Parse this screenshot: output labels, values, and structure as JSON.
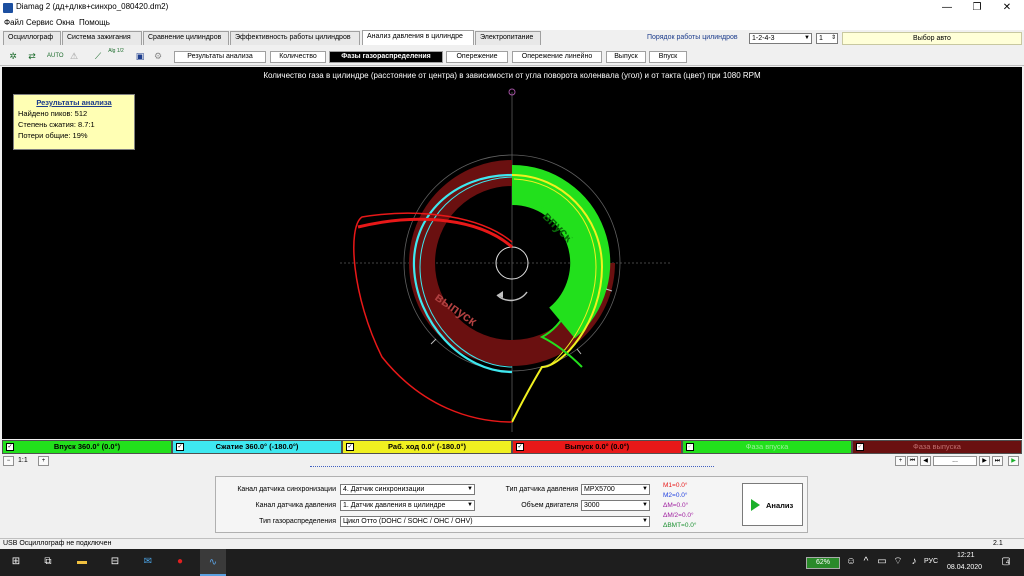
{
  "window": {
    "title": "Diamag 2 (дд+длкв+синхро_080420.dm2)",
    "minimize": "—",
    "maximize": "❐",
    "close": "✕"
  },
  "menu": [
    "Файл",
    "Сервис",
    "Окна",
    "Помощь"
  ],
  "tabs": [
    "Осциллограф",
    "Система зажигания",
    "Сравнение цилиндров",
    "Эффективность работы цилиндров",
    "Анализ давления в цилиндре",
    "Электропитание"
  ],
  "active_tab": "Анализ давления в цилиндре",
  "top_controls": {
    "cylinder_order_label": "Порядок работы цилиндров",
    "cylinder_order_value": "1-2-4-3",
    "cylinder_num": "1",
    "auto_select": "Выбор авто"
  },
  "toolbar_icons": [
    "settings-icon",
    "measure-icon",
    "auto-icon",
    "text-icon",
    "graph-icon",
    "scale-icon",
    "save-icon",
    "gear-icon"
  ],
  "toolbar_labels": {
    "auto": "AUTO",
    "scale": "Alg 1/2"
  },
  "subtabs": [
    "Результаты анализа",
    "Количество",
    "Фазы газораспределения",
    "Опережение",
    "Опережение линейно",
    "Выпуск",
    "Впуск"
  ],
  "active_subtab": "Фазы газораспределения",
  "plot": {
    "title": "Количество газа в цилиндре (расстояние от центра) в зависимости от угла поворота коленвала (угол) и от такта (цвет) при 1080 RPM",
    "intake_label": "впуск",
    "exhaust_label": "выпуск"
  },
  "results": {
    "header": "Результаты анализа",
    "peaks": "Найдено пиков: 512",
    "compression": "Степень сжатия: 8.7:1",
    "losses": "Потери общие: 19%"
  },
  "legend": [
    {
      "label": "Впуск 360.0° (0.0°)",
      "bg": "#22e01c",
      "fg": "#000000"
    },
    {
      "label": "Сжатие 360.0° (-180.0°)",
      "bg": "#3ee8f0",
      "fg": "#000000"
    },
    {
      "label": "Раб. ход 0.0° (-180.0°)",
      "bg": "#f0f020",
      "fg": "#000000"
    },
    {
      "label": "Выпуск 0.0° (0.0°)",
      "bg": "#e81818",
      "fg": "#000000"
    },
    {
      "label": "Фаза впуска",
      "bg": "#22e01c",
      "fg": "#9cf09c"
    },
    {
      "label": "Фаза выпуска",
      "bg": "#6a1010",
      "fg": "#c07070"
    }
  ],
  "navbar": {
    "zoom": "1:1",
    "dots": "..."
  },
  "bottom": {
    "sync_label": "Канал датчика синхронизации",
    "sync_value": "4. Датчик синхронизации",
    "pressure_label": "Канал датчика давления",
    "pressure_value": "1. Датчик давления в цилиндре",
    "timing_label": "Тип газораспределения",
    "timing_value": "Цикл Отто (DOHC / SOHC / OHC / OHV)",
    "sensor_type_label": "Тип датчика давления",
    "sensor_type_value": "MPX5700",
    "volume_label": "Объем двигателя",
    "volume_value": "3000",
    "m1": "M1=0.0°",
    "m2": "M2=0.0°",
    "dm": "ΔM=0.0°",
    "dm2": "ΔM/2=0.0°",
    "dmt": "ΔВМТ=0.0°",
    "analyze": "Анализ"
  },
  "status": {
    "left": "USB Осциллограф не подключен",
    "right": "2.1"
  },
  "taskbar": {
    "battery": "62%",
    "lang": "РУС",
    "time": "12:21",
    "date": "08.04.2020",
    "notif": "4"
  },
  "colors": {
    "intake": "#22e01c",
    "compression": "#3ee8f0",
    "power": "#f0f020",
    "exhaust": "#e81818",
    "exhaust_phase": "#6a1010"
  }
}
